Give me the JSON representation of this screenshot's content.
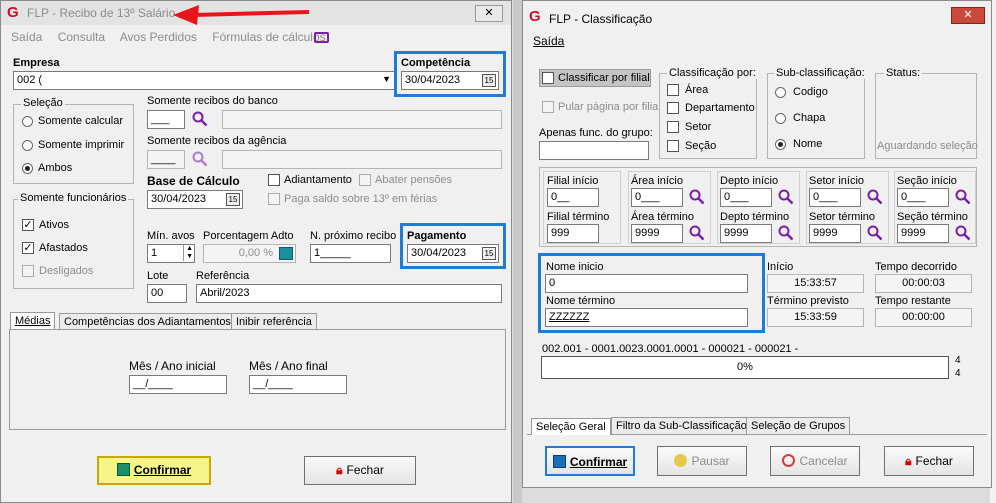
{
  "w1": {
    "logo": "G",
    "title": "FLP - Recibo de 13º Salário",
    "menu": [
      "Saída",
      "Consulta",
      "Avos Perdidos",
      "Fórmulas de cálculos"
    ],
    "empresa_label": "Empresa",
    "empresa_value": "002 (",
    "competencia_label": "Competência",
    "competencia_value": "30/04/2023",
    "selecao_label": "Seleção",
    "sel_calcular": "Somente calcular",
    "sel_imprimir": "Somente imprimir",
    "sel_ambos": "Ambos",
    "banco_label": "Somente recibos do banco",
    "banco_value": "___",
    "agencia_label": "Somente recibos da agência",
    "agencia_value": "____",
    "base_label": "Base de Cálculo",
    "base_value": "30/04/2023",
    "adiantamento": "Adiantamento",
    "abater": "Abater pensões",
    "paga_saldo": "Paga saldo sobre 13º em férias",
    "func_label": "Somente funcionários",
    "ativos": "Ativos",
    "afastados": "Afastados",
    "desligados": "Desligados",
    "min_avos_label": "Mín. avos",
    "min_avos_value": "1",
    "porcentagem_label": "Porcentagem Adto",
    "porcentagem_value": "0,00 %",
    "proximo_label": "N. próximo recibo",
    "proximo_value": "1_____",
    "pagamento_label": "Pagamento",
    "pagamento_value": "30/04/2023",
    "lote_label": "Lote",
    "lote_value": "00",
    "referencia_label": "Referência",
    "referencia_value": "Abril/2023",
    "tabs": [
      "Médias",
      "Competências dos Adiantamentos",
      "Inibir referência"
    ],
    "mes_inicial_label": "Mês / Ano inicial",
    "mes_inicial_value": "__/____",
    "mes_final_label": "Mês / Ano final",
    "mes_final_value": "__/____",
    "confirmar": "Confirmar",
    "fechar": "Fechar"
  },
  "w2": {
    "logo": "G",
    "title": "FLP - Classificação",
    "menu": [
      "Saída"
    ],
    "classificar_filial": "Classificar por filial",
    "pular_pagina": "Pular página por filial",
    "apenas_func": "Apenas func. do grupo:",
    "class_por_label": "Classificação por:",
    "cp_area": "Área",
    "cp_departamento": "Departamento",
    "cp_setor": "Setor",
    "cp_secao": "Seção",
    "sub_label": "Sub-classificação:",
    "sub_codigo": "Codigo",
    "sub_chapa": "Chapa",
    "sub_nome": "Nome",
    "status_label": "Status:",
    "status_value": "Aguardando seleção",
    "filial_inicio_label": "Filial início",
    "filial_inicio_value": "0__",
    "filial_termino_label": "Filial término",
    "filial_termino_value": "999",
    "area_inicio_label": "Área início",
    "area_inicio_value": "0___",
    "area_termino_label": "Área término",
    "area_termino_value": "9999",
    "depto_inicio_label": "Depto início",
    "depto_inicio_value": "0___",
    "depto_termino_label": "Depto término",
    "depto_termino_value": "9999",
    "setor_inicio_label": "Setor início",
    "setor_inicio_value": "0___",
    "setor_termino_label": "Setor término",
    "setor_termino_value": "9999",
    "secao_inicio_label": "Seção início",
    "secao_inicio_value": "0___",
    "secao_termino_label": "Seção término",
    "secao_termino_value": "9999",
    "nome_inicio_label": "Nome inicio",
    "nome_inicio_value": "0",
    "nome_termino_label": "Nome término",
    "nome_termino_value": "ZZZZZZ",
    "inicio_label": "Início",
    "inicio_value": "15:33:57",
    "decorrido_label": "Tempo decorrido",
    "decorrido_value": "00:00:03",
    "termino_previsto_label": "Término previsto",
    "termino_previsto_value": "15:33:59",
    "restante_label": "Tempo restante",
    "restante_value": "00:00:00",
    "path_text": "002.001 - 0001.0023.0001.0001 - 000021 - 000021 -",
    "progress_text": "0%",
    "progress_fraction": 0,
    "count_top": "4",
    "count_bottom": "4",
    "tabs": [
      "Seleção Geral",
      "Filtro da Sub-Classificação",
      "Seleção de Grupos"
    ],
    "confirmar": "Confirmar",
    "pausar": "Pausar",
    "cancelar": "Cancelar",
    "fechar": "Fechar"
  },
  "colors": {
    "highlight": "#1e7bd8",
    "arrow": "#e8141b",
    "confirm_bg": "#f5f58a",
    "confirm_border": "#c8a800",
    "search_icon": "#7a1fa8",
    "lock_icon": "#d40000",
    "title_logo": "#c8102e"
  }
}
